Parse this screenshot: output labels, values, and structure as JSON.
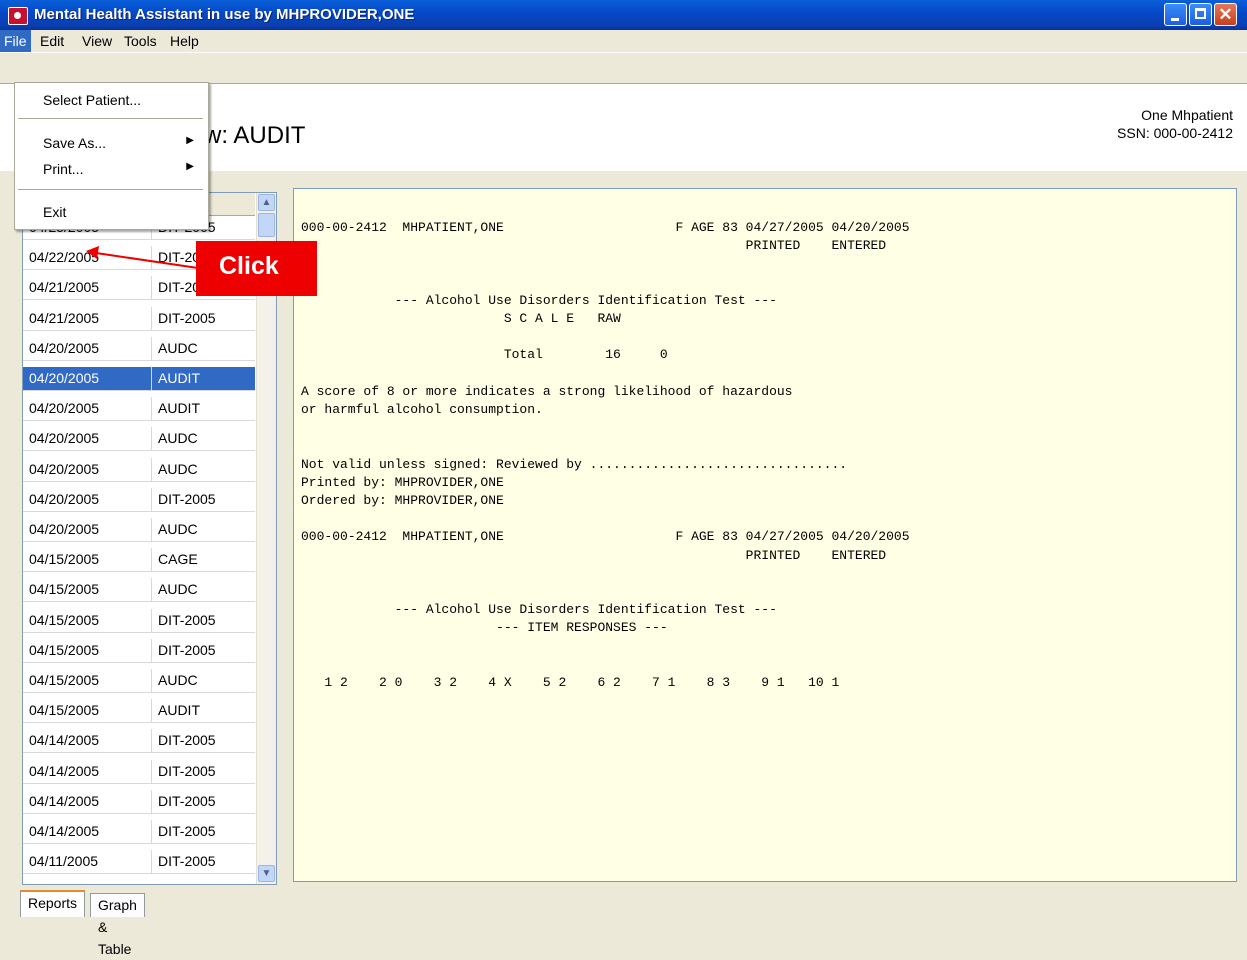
{
  "window": {
    "title": "Mental Health Assistant in use by MHPROVIDER,ONE",
    "icon": "app-icon"
  },
  "menu": {
    "items": [
      "File",
      "Edit",
      "View",
      "Tools",
      "Help"
    ],
    "active": "File",
    "file_dropdown": {
      "select_patient": "Select Patient...",
      "save_as": "Save As...",
      "print": "Print...",
      "exit": "Exit"
    }
  },
  "header": {
    "title": "Results Review: AUDIT",
    "patient_name": "One Mhpatient",
    "patient_ssn": "SSN: 000-00-2412"
  },
  "results_list": {
    "rows": [
      {
        "date": "04/25/2005",
        "test": "DIT-2005"
      },
      {
        "date": "04/22/2005",
        "test": "DIT-2005"
      },
      {
        "date": "04/21/2005",
        "test": "DIT-2005"
      },
      {
        "date": "04/21/2005",
        "test": "DIT-2005"
      },
      {
        "date": "04/20/2005",
        "test": "AUDC"
      },
      {
        "date": "04/20/2005",
        "test": "AUDIT",
        "selected": true
      },
      {
        "date": "04/20/2005",
        "test": "AUDIT"
      },
      {
        "date": "04/20/2005",
        "test": "AUDC"
      },
      {
        "date": "04/20/2005",
        "test": "AUDC"
      },
      {
        "date": "04/20/2005",
        "test": "DIT-2005"
      },
      {
        "date": "04/20/2005",
        "test": "AUDC"
      },
      {
        "date": "04/15/2005",
        "test": "CAGE"
      },
      {
        "date": "04/15/2005",
        "test": "AUDC"
      },
      {
        "date": "04/15/2005",
        "test": "DIT-2005"
      },
      {
        "date": "04/15/2005",
        "test": "DIT-2005"
      },
      {
        "date": "04/15/2005",
        "test": "AUDC"
      },
      {
        "date": "04/15/2005",
        "test": "AUDIT"
      },
      {
        "date": "04/14/2005",
        "test": "DIT-2005"
      },
      {
        "date": "04/14/2005",
        "test": "DIT-2005"
      },
      {
        "date": "04/14/2005",
        "test": "DIT-2005"
      },
      {
        "date": "04/14/2005",
        "test": "DIT-2005"
      },
      {
        "date": "04/11/2005",
        "test": "DIT-2005"
      }
    ]
  },
  "report": {
    "lines": [
      "000-00-2412  MHPATIENT,ONE                      F AGE 83 04/27/2005 04/20/2005",
      "                                                         PRINTED    ENTERED",
      "",
      "",
      "            --- Alcohol Use Disorders Identification Test ---",
      "                          S C A L E   RAW",
      "",
      "                          Total        16     0",
      "",
      "A score of 8 or more indicates a strong likelihood of hazardous",
      "or harmful alcohol consumption.",
      "",
      "",
      "Not valid unless signed: Reviewed by .................................",
      "Printed by: MHPROVIDER,ONE",
      "Ordered by: MHPROVIDER,ONE",
      "",
      "000-00-2412  MHPATIENT,ONE                      F AGE 83 04/27/2005 04/20/2005",
      "                                                         PRINTED    ENTERED",
      "",
      "",
      "            --- Alcohol Use Disorders Identification Test ---",
      "                         --- ITEM RESPONSES ---",
      "",
      "",
      "   1 2    2 0    3 2    4 X    5 2    6 2    7 1    8 3    9 1   10 1"
    ]
  },
  "tabs": {
    "reports": "Reports",
    "graph_table": "Graph & Table",
    "active": "Reports"
  },
  "callout": {
    "text": "Click",
    "color": "#ee0000"
  },
  "colors": {
    "selection": "#316ac5",
    "report_background": "#ffffe6",
    "titlebar": "#0549c9"
  }
}
